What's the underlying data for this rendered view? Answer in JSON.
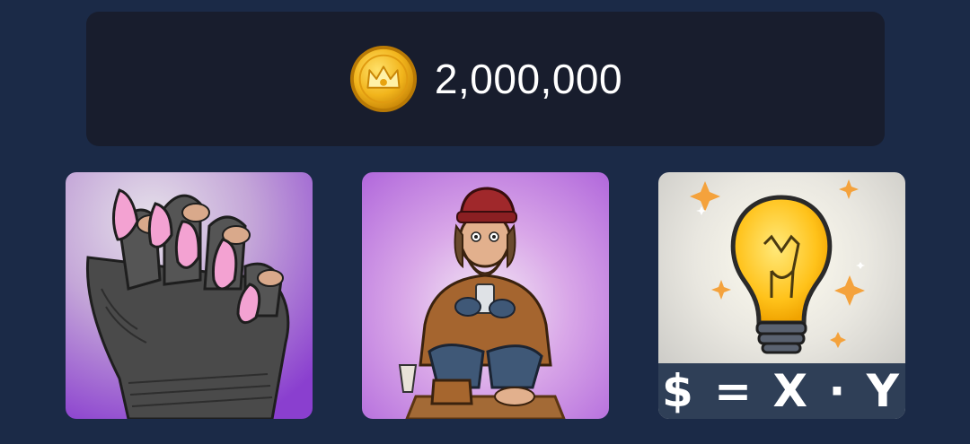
{
  "balance": {
    "value": "2,000,000",
    "icon": "crown-coin-icon"
  },
  "cards": [
    {
      "name": "nails-glove-card",
      "image": "gloved-hand-with-pink-nails"
    },
    {
      "name": "homeless-man-card",
      "image": "homeless-man-with-phone"
    },
    {
      "name": "lightbulb-formula-card",
      "image": "lightbulb",
      "formula": "$ = X · Y"
    }
  ],
  "colors": {
    "background": "#1b2a47",
    "panel": "#181d2d",
    "text": "#ffffff",
    "coin": "#f2b51c"
  }
}
